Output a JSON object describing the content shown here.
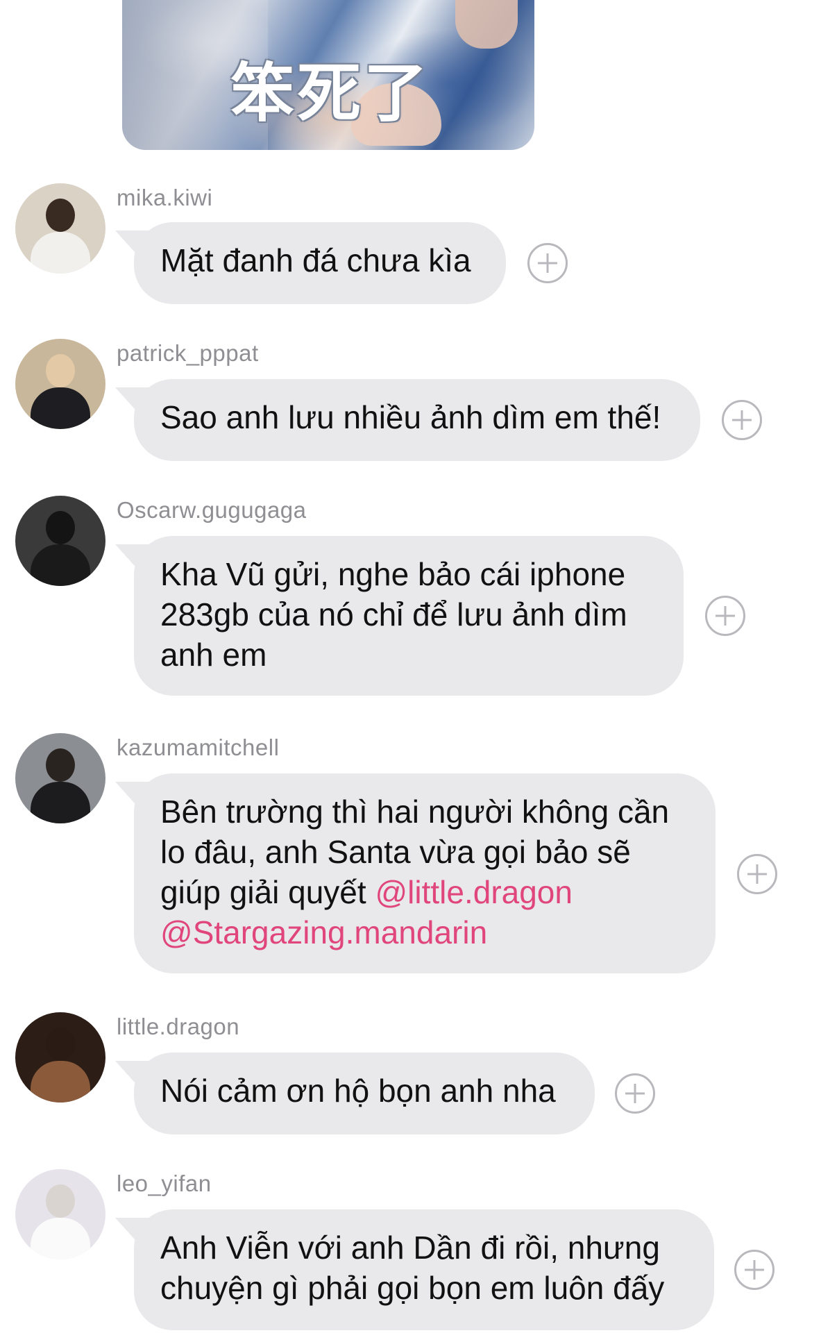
{
  "sticker": {
    "caption": "笨死了",
    "icon": "reaction-image"
  },
  "messages": [
    {
      "username": "mika.kiwi",
      "text": "Mặt đanh đá chưa kìa",
      "avatar": {
        "bg": "#d9d2c5",
        "head": "#3a2b22",
        "body": "#f2f0ec"
      }
    },
    {
      "username": "patrick_pppat",
      "text": "Sao anh lưu nhiều ảnh dìm em thế!",
      "avatar": {
        "bg": "#c9b79b",
        "head": "#e3c9a6",
        "body": "#1d1d22"
      }
    },
    {
      "username": "Oscarw.gugugaga",
      "text": "Kha Vũ gửi, nghe bảo cái iphone 283gb của nó chỉ để lưu ảnh dìm anh em",
      "avatar": {
        "bg": "#3a3a3a",
        "head": "#141414",
        "body": "#1a1a1a"
      }
    },
    {
      "username": "kazumamitchell",
      "text": "Bên trường thì hai người không cần lo đâu, anh Santa vừa gọi bảo sẽ giúp giải quyết ",
      "mentions": [
        "@little.dragon",
        "@Stargazing.mandarin"
      ],
      "avatar": {
        "bg": "#8b8f94",
        "head": "#2a2420",
        "body": "#1c1c1e"
      }
    },
    {
      "username": "little.dragon",
      "text": "Nói cảm ơn hộ bọn anh nha",
      "avatar": {
        "bg": "#2c1d16",
        "head": "#2a1b14",
        "body": "#8a5a3a"
      }
    },
    {
      "username": "leo_yifan",
      "text": "Anh Viễn với anh Dần đi rồi, nhưng chuyện gì phải gọi bọn em luôn đấy",
      "avatar": {
        "bg": "#e6e3ea",
        "head": "#f4f4f4",
        "body": "#fafafa"
      }
    }
  ],
  "icons": {
    "add_reaction": "plus-circle-icon"
  }
}
